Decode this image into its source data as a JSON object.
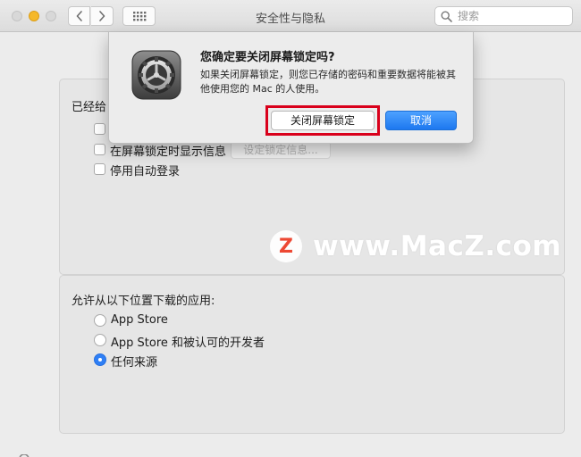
{
  "window": {
    "title": "安全性与隐私"
  },
  "toolbar": {
    "search_placeholder": "搜索"
  },
  "general": {
    "password_label_partial": "已经给",
    "option_show_message": "在屏幕锁定时显示信息",
    "option_show_message_checked": false,
    "set_lock_message_button": "设定锁定信息...",
    "option_disable_auto_login": "停用自动登录",
    "option_disable_auto_login_checked": false
  },
  "downloads": {
    "heading": "允许从以下位置下载的应用:",
    "options": [
      {
        "label": "App Store",
        "selected": false
      },
      {
        "label": "App Store 和被认可的开发者",
        "selected": false
      },
      {
        "label": "任何来源",
        "selected": true
      }
    ]
  },
  "dialog": {
    "title": "您确定要关闭屏幕锁定吗?",
    "message": "如果关闭屏幕锁定，则您已存储的密码和重要数据将能被其他使用您的 Mac 的人使用。",
    "confirm_label": "关闭屏幕锁定",
    "cancel_label": "取消",
    "icon": "system-preferences-gear-icon"
  },
  "watermark": {
    "logo_letter": "Z",
    "text": "www.MacZ.com"
  },
  "colors": {
    "accent": "#2f7ff5",
    "highlight": "#d9001b",
    "watermark_logo": "#ee3b24"
  }
}
